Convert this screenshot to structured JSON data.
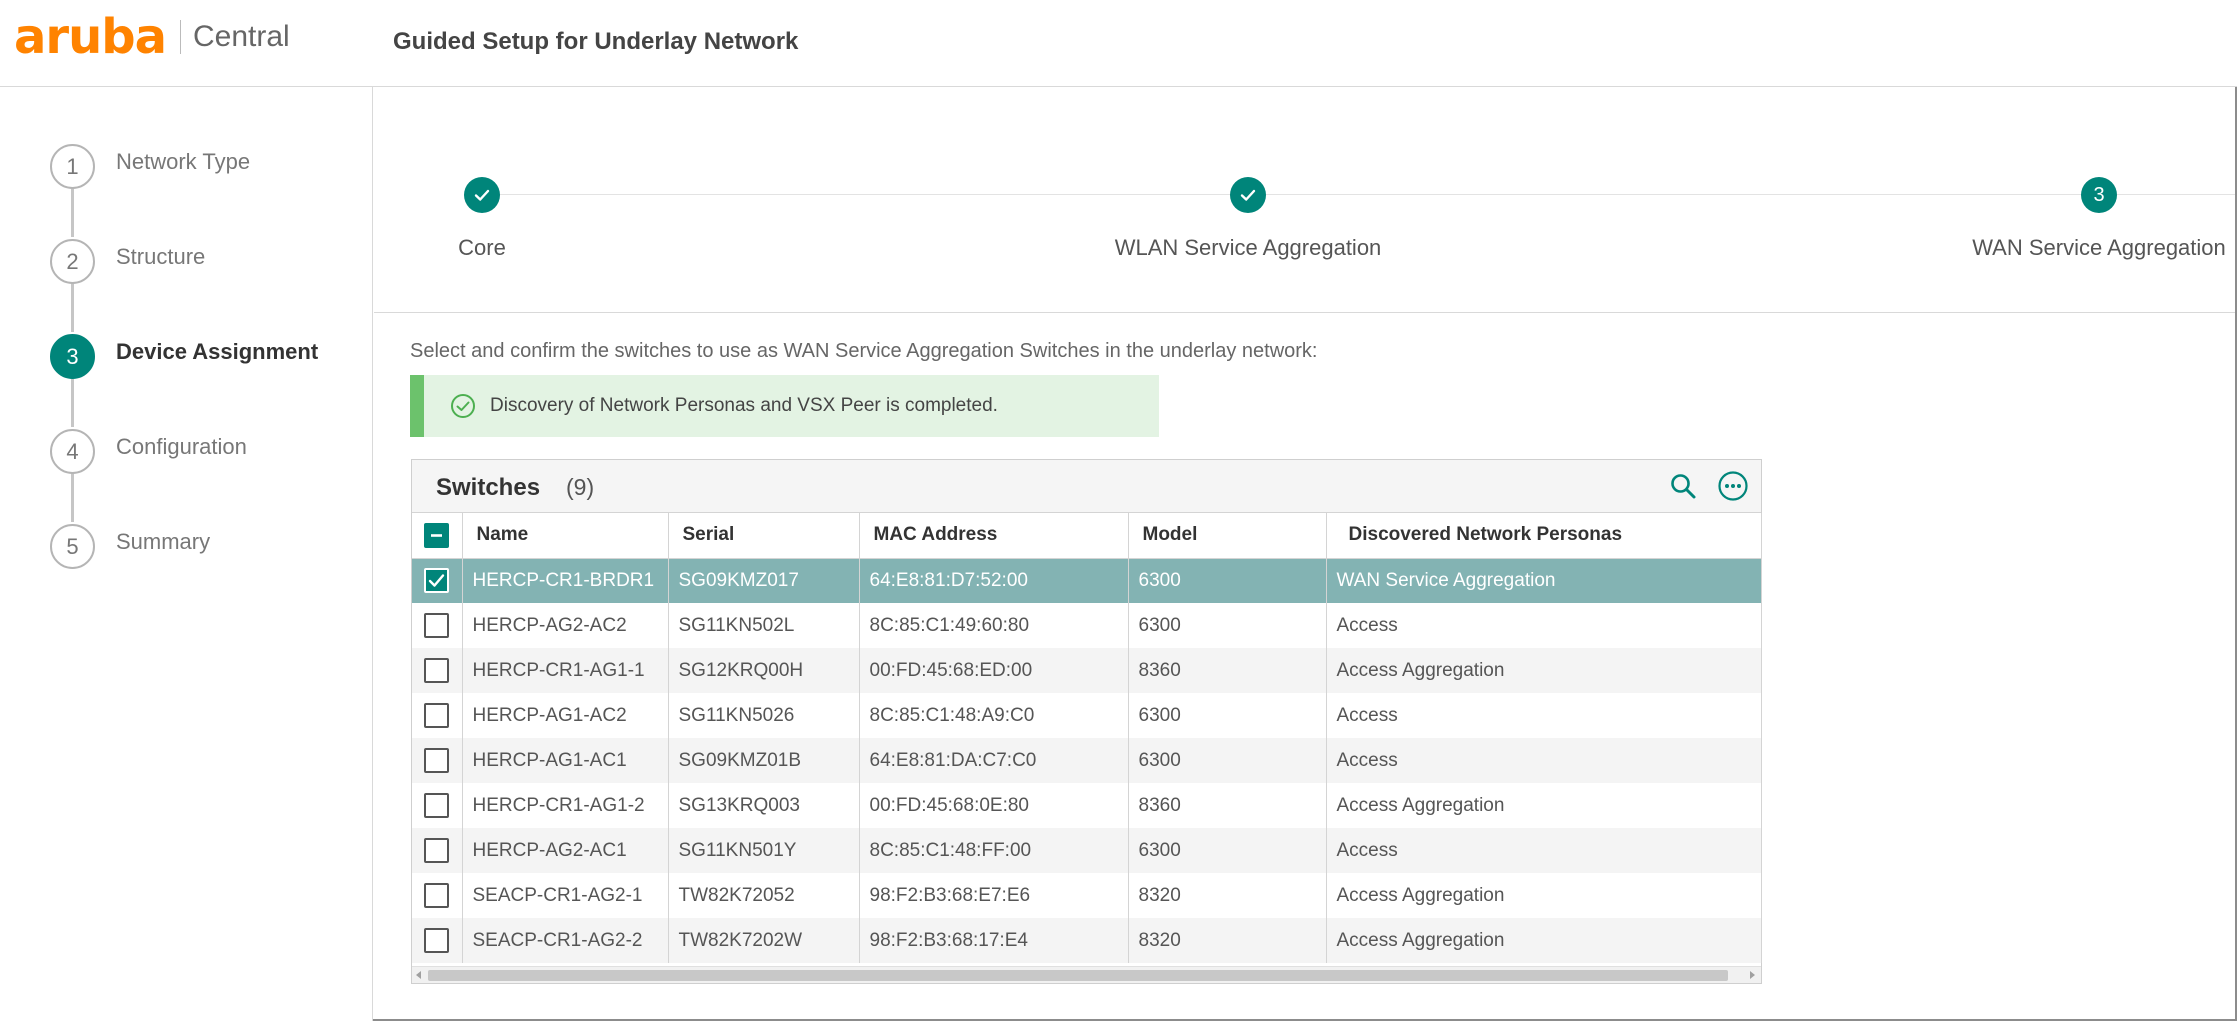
{
  "brand": {
    "logo": "aruba",
    "product": "Central",
    "accent": "#ff8300"
  },
  "page": {
    "title": "Guided Setup for Underlay Network"
  },
  "steps": [
    {
      "num": "1",
      "label": "Network Type",
      "state": "inactive"
    },
    {
      "num": "2",
      "label": "Structure",
      "state": "inactive"
    },
    {
      "num": "3",
      "label": "Device Assignment",
      "state": "active"
    },
    {
      "num": "4",
      "label": "Configuration",
      "state": "inactive"
    },
    {
      "num": "5",
      "label": "Summary",
      "state": "inactive"
    }
  ],
  "progress": [
    {
      "label": "Core",
      "state": "done",
      "icon": "check-icon"
    },
    {
      "label": "WLAN Service Aggregation",
      "state": "done",
      "icon": "check-icon"
    },
    {
      "label": "WAN Service Aggregation",
      "state": "current",
      "num": "3"
    }
  ],
  "instruction": "Select and confirm the switches to use as WAN Service Aggregation Switches in the underlay network:",
  "alert": {
    "text": "Discovery of Network Personas and VSX Peer is completed.",
    "icon": "success-check-icon"
  },
  "table": {
    "title": "Switches",
    "count": "(9)",
    "columns": [
      "Name",
      "Serial",
      "MAC Address",
      "Model",
      "Discovered Network Personas"
    ],
    "rows": [
      {
        "selected": true,
        "name": "HERCP-CR1-BRDR1",
        "serial": "SG09KMZ017",
        "mac": "64:E8:81:D7:52:00",
        "model": "6300",
        "persona": "WAN Service Aggregation"
      },
      {
        "selected": false,
        "name": "HERCP-AG2-AC2",
        "serial": "SG11KN502L",
        "mac": "8C:85:C1:49:60:80",
        "model": "6300",
        "persona": "Access"
      },
      {
        "selected": false,
        "name": "HERCP-CR1-AG1-1",
        "serial": "SG12KRQ00H",
        "mac": "00:FD:45:68:ED:00",
        "model": "8360",
        "persona": "Access Aggregation"
      },
      {
        "selected": false,
        "name": "HERCP-AG1-AC2",
        "serial": "SG11KN5026",
        "mac": "8C:85:C1:48:A9:C0",
        "model": "6300",
        "persona": "Access"
      },
      {
        "selected": false,
        "name": "HERCP-AG1-AC1",
        "serial": "SG09KMZ01B",
        "mac": "64:E8:81:DA:C7:C0",
        "model": "6300",
        "persona": "Access"
      },
      {
        "selected": false,
        "name": "HERCP-CR1-AG1-2",
        "serial": "SG13KRQ003",
        "mac": "00:FD:45:68:0E:80",
        "model": "8360",
        "persona": "Access Aggregation"
      },
      {
        "selected": false,
        "name": "HERCP-AG2-AC1",
        "serial": "SG11KN501Y",
        "mac": "8C:85:C1:48:FF:00",
        "model": "6300",
        "persona": "Access"
      },
      {
        "selected": false,
        "name": "SEACP-CR1-AG2-1",
        "serial": "TW82K72052",
        "mac": "98:F2:B3:68:E7:E6",
        "model": "8320",
        "persona": "Access Aggregation"
      },
      {
        "selected": false,
        "name": "SEACP-CR1-AG2-2",
        "serial": "TW82K7202W",
        "mac": "98:F2:B3:68:17:E4",
        "model": "8320",
        "persona": "Access Aggregation"
      }
    ]
  },
  "colors": {
    "teal": "#00857a",
    "selected_row": "#83b3b3",
    "alert_bg": "#e3f3e3",
    "alert_bar": "#6cc26c"
  }
}
